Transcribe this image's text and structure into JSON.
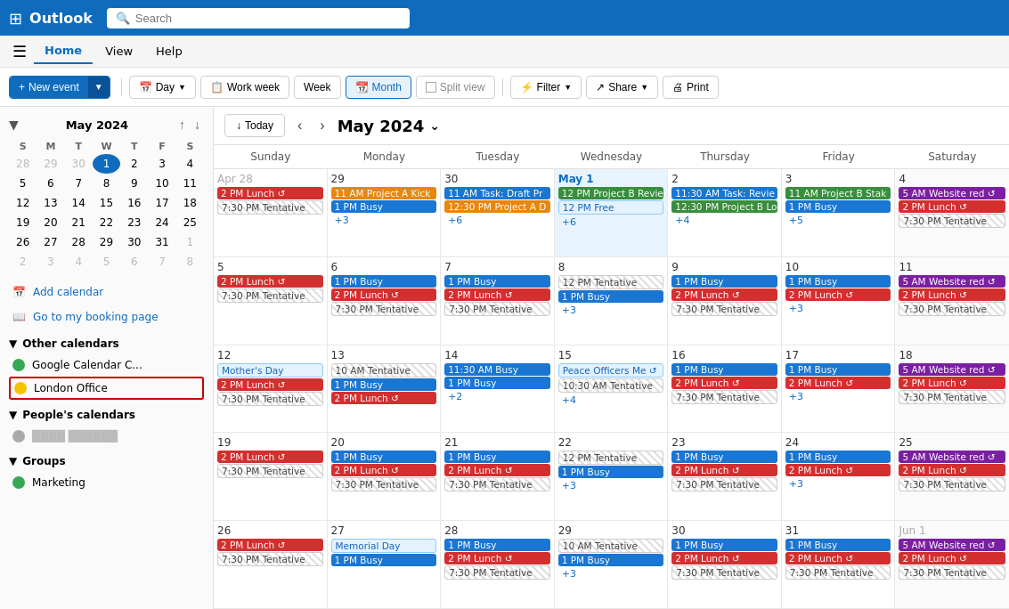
{
  "app": {
    "name": "Outlook"
  },
  "search": {
    "placeholder": "Search"
  },
  "ribbon": {
    "tabs": [
      "Home",
      "View",
      "Help"
    ],
    "active": "Home"
  },
  "toolbar": {
    "new_event": "New event",
    "day": "Day",
    "work_week": "Work week",
    "week": "Week",
    "month": "Month",
    "split_view": "Split view",
    "filter": "Filter",
    "share": "Share",
    "print": "Print"
  },
  "mini_calendar": {
    "title": "May 2024",
    "days": [
      "S",
      "M",
      "T",
      "W",
      "T",
      "F",
      "S"
    ],
    "weeks": [
      [
        {
          "n": 28,
          "o": true
        },
        {
          "n": 29,
          "o": true
        },
        {
          "n": 30,
          "o": true
        },
        {
          "n": 1,
          "o": false,
          "today": true
        },
        {
          "n": 2,
          "o": false
        },
        {
          "n": 3,
          "o": false
        },
        {
          "n": 4,
          "o": false
        }
      ],
      [
        {
          "n": 5,
          "o": false
        },
        {
          "n": 6,
          "o": false
        },
        {
          "n": 7,
          "o": false
        },
        {
          "n": 8,
          "o": false
        },
        {
          "n": 9,
          "o": false
        },
        {
          "n": 10,
          "o": false
        },
        {
          "n": 11,
          "o": false
        }
      ],
      [
        {
          "n": 12,
          "o": false
        },
        {
          "n": 13,
          "o": false
        },
        {
          "n": 14,
          "o": false
        },
        {
          "n": 15,
          "o": false
        },
        {
          "n": 16,
          "o": false
        },
        {
          "n": 17,
          "o": false
        },
        {
          "n": 18,
          "o": false
        }
      ],
      [
        {
          "n": 19,
          "o": false
        },
        {
          "n": 20,
          "o": false
        },
        {
          "n": 21,
          "o": false
        },
        {
          "n": 22,
          "o": false
        },
        {
          "n": 23,
          "o": false
        },
        {
          "n": 24,
          "o": false
        },
        {
          "n": 25,
          "o": false
        }
      ],
      [
        {
          "n": 26,
          "o": false
        },
        {
          "n": 27,
          "o": false
        },
        {
          "n": 28,
          "o": false
        },
        {
          "n": 29,
          "o": false
        },
        {
          "n": 30,
          "o": false
        },
        {
          "n": 31,
          "o": false
        },
        {
          "n": 1,
          "o": true
        }
      ],
      [
        {
          "n": 2,
          "o": true
        },
        {
          "n": 3,
          "o": true
        },
        {
          "n": 4,
          "o": true
        },
        {
          "n": 5,
          "o": true
        },
        {
          "n": 6,
          "o": true
        },
        {
          "n": 7,
          "o": true
        },
        {
          "n": 8,
          "o": true
        }
      ]
    ]
  },
  "sidebar": {
    "add_calendar": "Add calendar",
    "booking_page": "Go to my booking page",
    "other_calendars_label": "Other calendars",
    "google_calendar": "Google Calendar C...",
    "london_office": "London Office",
    "peoples_calendars_label": "People's calendars",
    "groups_label": "Groups",
    "marketing": "Marketing"
  },
  "calendar": {
    "today_btn": "Today",
    "title": "May 2024",
    "day_labels": [
      "Sunday",
      "Monday",
      "Tuesday",
      "Wednesday",
      "Thursday",
      "Friday",
      "Saturday"
    ],
    "rows": [
      {
        "cells": [
          {
            "date": "Apr 28",
            "other": true,
            "events": [
              {
                "t": "2 PM Lunch",
                "c": "red",
                "icon": "↺"
              },
              {
                "t": "7:30 PM Tentative",
                "c": "striped"
              }
            ]
          },
          {
            "date": "29",
            "events": [
              {
                "t": "11 AM Project A Kick",
                "c": "orange"
              },
              {
                "t": "1 PM Busy",
                "c": "blue"
              },
              {
                "t": "+3",
                "more": true
              }
            ]
          },
          {
            "date": "30",
            "events": [
              {
                "t": "11 AM Task: Draft Pr",
                "c": "blue"
              },
              {
                "t": "12:30 PM Project A D",
                "c": "orange"
              },
              {
                "t": "+6",
                "more": true
              }
            ]
          },
          {
            "date": "May 1",
            "today": true,
            "events": [
              {
                "t": "12 PM Project B Revie",
                "c": "green"
              },
              {
                "t": "12 PM Free",
                "c": "light-blue"
              },
              {
                "t": "+6",
                "more": true
              }
            ]
          },
          {
            "date": "2",
            "events": [
              {
                "t": "11:30 AM Task: Revie",
                "c": "blue"
              },
              {
                "t": "12:30 PM Project B Lo",
                "c": "green"
              },
              {
                "t": "+4",
                "more": true
              }
            ]
          },
          {
            "date": "3",
            "events": [
              {
                "t": "11 AM Project B Stak",
                "c": "green"
              },
              {
                "t": "1 PM Busy",
                "c": "blue"
              },
              {
                "t": "+5",
                "more": true
              }
            ]
          },
          {
            "date": "4",
            "sat": true,
            "events": [
              {
                "t": "5 AM Website red",
                "c": "purple",
                "icon": "↺"
              },
              {
                "t": "2 PM Lunch",
                "c": "red",
                "icon": "↺"
              },
              {
                "t": "7:30 PM Tentative",
                "c": "striped"
              }
            ]
          }
        ]
      },
      {
        "cells": [
          {
            "date": "5",
            "events": [
              {
                "t": "2 PM Lunch",
                "c": "red",
                "icon": "↺"
              },
              {
                "t": "7:30 PM Tentative",
                "c": "striped"
              }
            ]
          },
          {
            "date": "6",
            "events": [
              {
                "t": "1 PM Busy",
                "c": "blue"
              },
              {
                "t": "2 PM Lunch",
                "c": "red",
                "icon": "↺"
              },
              {
                "t": "7:30 PM Tentative",
                "c": "striped"
              }
            ]
          },
          {
            "date": "7",
            "events": [
              {
                "t": "1 PM Busy",
                "c": "blue"
              },
              {
                "t": "2 PM Lunch",
                "c": "red",
                "icon": "↺"
              },
              {
                "t": "7:30 PM Tentative",
                "c": "striped"
              }
            ]
          },
          {
            "date": "8",
            "events": [
              {
                "t": "12 PM Tentative",
                "c": "striped"
              },
              {
                "t": "1 PM Busy",
                "c": "blue"
              },
              {
                "t": "+3",
                "more": true
              }
            ]
          },
          {
            "date": "9",
            "events": [
              {
                "t": "1 PM Busy",
                "c": "blue"
              },
              {
                "t": "2 PM Lunch",
                "c": "red",
                "icon": "↺"
              },
              {
                "t": "7:30 PM Tentative",
                "c": "striped"
              }
            ]
          },
          {
            "date": "10",
            "events": [
              {
                "t": "1 PM Busy",
                "c": "blue"
              },
              {
                "t": "2 PM Lunch",
                "c": "red",
                "icon": "↺"
              },
              {
                "t": "+3",
                "more": true
              }
            ]
          },
          {
            "date": "11",
            "sat": true,
            "events": [
              {
                "t": "5 AM Website red",
                "c": "purple",
                "icon": "↺"
              },
              {
                "t": "2 PM Lunch",
                "c": "red",
                "icon": "↺"
              },
              {
                "t": "7:30 PM Tentative",
                "c": "striped"
              }
            ]
          }
        ]
      },
      {
        "cells": [
          {
            "date": "12",
            "events": [
              {
                "t": "Mother's Day",
                "c": "light-blue",
                "allday": true
              },
              {
                "t": "2 PM Lunch",
                "c": "red",
                "icon": "↺"
              },
              {
                "t": "7:30 PM Tentative",
                "c": "striped"
              }
            ]
          },
          {
            "date": "13",
            "events": [
              {
                "t": "10 AM Tentative",
                "c": "striped"
              },
              {
                "t": "1 PM Busy",
                "c": "blue"
              },
              {
                "t": "2 PM Lunch",
                "c": "red",
                "icon": "↺"
              }
            ]
          },
          {
            "date": "14",
            "events": [
              {
                "t": "11:30 AM Busy",
                "c": "blue"
              },
              {
                "t": "1 PM Busy",
                "c": "blue"
              },
              {
                "t": "+2",
                "more": true
              }
            ]
          },
          {
            "date": "15",
            "events": [
              {
                "t": "Peace Officers Me",
                "c": "light-blue",
                "icon": "↺"
              },
              {
                "t": "10:30 AM Tentative",
                "c": "striped"
              },
              {
                "t": "+4",
                "more": true
              }
            ]
          },
          {
            "date": "16",
            "events": [
              {
                "t": "1 PM Busy",
                "c": "blue"
              },
              {
                "t": "2 PM Lunch",
                "c": "red",
                "icon": "↺"
              },
              {
                "t": "7:30 PM Tentative",
                "c": "striped"
              }
            ]
          },
          {
            "date": "17",
            "events": [
              {
                "t": "1 PM Busy",
                "c": "blue"
              },
              {
                "t": "2 PM Lunch",
                "c": "red",
                "icon": "↺"
              },
              {
                "t": "+3",
                "more": true
              }
            ]
          },
          {
            "date": "18",
            "sat": true,
            "events": [
              {
                "t": "5 AM Website red",
                "c": "purple",
                "icon": "↺"
              },
              {
                "t": "2 PM Lunch",
                "c": "red",
                "icon": "↺"
              },
              {
                "t": "7:30 PM Tentative",
                "c": "striped"
              }
            ]
          }
        ]
      },
      {
        "cells": [
          {
            "date": "19",
            "events": [
              {
                "t": "2 PM Lunch",
                "c": "red",
                "icon": "↺"
              },
              {
                "t": "7:30 PM Tentative",
                "c": "striped"
              }
            ]
          },
          {
            "date": "20",
            "events": [
              {
                "t": "1 PM Busy",
                "c": "blue"
              },
              {
                "t": "2 PM Lunch",
                "c": "red",
                "icon": "↺"
              },
              {
                "t": "7:30 PM Tentative",
                "c": "striped"
              }
            ]
          },
          {
            "date": "21",
            "events": [
              {
                "t": "1 PM Busy",
                "c": "blue"
              },
              {
                "t": "2 PM Lunch",
                "c": "red",
                "icon": "↺"
              },
              {
                "t": "7:30 PM Tentative",
                "c": "striped"
              }
            ]
          },
          {
            "date": "22",
            "events": [
              {
                "t": "12 PM Tentative",
                "c": "striped"
              },
              {
                "t": "1 PM Busy",
                "c": "blue"
              },
              {
                "t": "+3",
                "more": true
              }
            ]
          },
          {
            "date": "23",
            "events": [
              {
                "t": "1 PM Busy",
                "c": "blue"
              },
              {
                "t": "2 PM Lunch",
                "c": "red",
                "icon": "↺"
              },
              {
                "t": "7:30 PM Tentative",
                "c": "striped"
              }
            ]
          },
          {
            "date": "24",
            "events": [
              {
                "t": "1 PM Busy",
                "c": "blue"
              },
              {
                "t": "2 PM Lunch",
                "c": "red",
                "icon": "↺"
              },
              {
                "t": "+3",
                "more": true
              }
            ]
          },
          {
            "date": "25",
            "sat": true,
            "events": [
              {
                "t": "5 AM Website red",
                "c": "purple",
                "icon": "↺"
              },
              {
                "t": "2 PM Lunch",
                "c": "red",
                "icon": "↺"
              },
              {
                "t": "7:30 PM Tentative",
                "c": "striped"
              }
            ]
          }
        ]
      },
      {
        "cells": [
          {
            "date": "26",
            "events": [
              {
                "t": "2 PM Lunch",
                "c": "red",
                "icon": "↺"
              },
              {
                "t": "7:30 PM Tentative",
                "c": "striped"
              }
            ]
          },
          {
            "date": "27",
            "events": [
              {
                "t": "Memorial Day",
                "c": "light-blue",
                "allday": true
              },
              {
                "t": "1 PM Busy",
                "c": "blue"
              }
            ]
          },
          {
            "date": "28",
            "events": [
              {
                "t": "1 PM Busy",
                "c": "blue"
              },
              {
                "t": "2 PM Lunch",
                "c": "red",
                "icon": "↺"
              },
              {
                "t": "7:30 PM Tentative",
                "c": "striped"
              }
            ]
          },
          {
            "date": "29",
            "events": [
              {
                "t": "10 AM Tentative",
                "c": "striped"
              },
              {
                "t": "1 PM Busy",
                "c": "blue"
              },
              {
                "t": "+3",
                "more": true
              }
            ]
          },
          {
            "date": "30",
            "events": [
              {
                "t": "1 PM Busy",
                "c": "blue"
              },
              {
                "t": "2 PM Lunch",
                "c": "red",
                "icon": "↺"
              },
              {
                "t": "7:30 PM Tentative",
                "c": "striped"
              }
            ]
          },
          {
            "date": "31",
            "events": [
              {
                "t": "1 PM Busy",
                "c": "blue"
              },
              {
                "t": "2 PM Lunch",
                "c": "red",
                "icon": "↺"
              },
              {
                "t": "7:30 PM Tentative",
                "c": "striped"
              }
            ]
          },
          {
            "date": "Jun 1",
            "other": true,
            "sat": true,
            "events": [
              {
                "t": "5 AM Website red",
                "c": "purple",
                "icon": "↺"
              },
              {
                "t": "2 PM Lunch",
                "c": "red",
                "icon": "↺"
              },
              {
                "t": "7:30 PM Tentative",
                "c": "striped"
              }
            ]
          }
        ]
      }
    ]
  }
}
